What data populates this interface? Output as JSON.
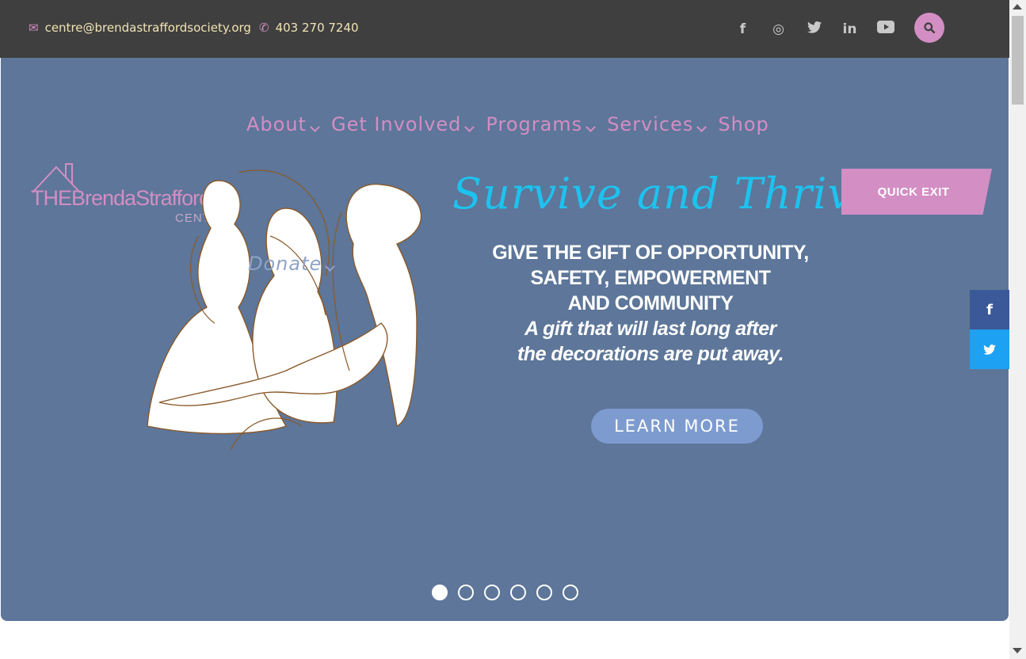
{
  "topbar": {
    "email": "centre@brendastraffordsociety.org",
    "phone": "403 270 7240",
    "email_icon": "envelope-icon",
    "phone_icon": "phone-icon",
    "social": [
      {
        "name": "facebook-icon",
        "glyph": "f"
      },
      {
        "name": "instagram-icon",
        "glyph": "◎"
      },
      {
        "name": "twitter-icon",
        "glyph": "🐦"
      },
      {
        "name": "linkedin-icon",
        "glyph": "in"
      },
      {
        "name": "youtube-icon",
        "glyph": "▶"
      }
    ],
    "search_icon": "search-icon"
  },
  "nav": {
    "items": [
      {
        "label": "About",
        "has_dropdown": true
      },
      {
        "label": "Get Involved",
        "has_dropdown": true
      },
      {
        "label": "Programs",
        "has_dropdown": true
      },
      {
        "label": "Services",
        "has_dropdown": true
      },
      {
        "label": "Shop",
        "has_dropdown": false
      }
    ],
    "donate": "Donate"
  },
  "logo": {
    "text": "THEBrendaStrafford",
    "sub": "CENTRE"
  },
  "hero": {
    "script_title": "Survive and Thrive",
    "headline_1": "GIVE THE GIFT OF OPPORTUNITY,",
    "headline_2": "SAFETY, EMPOWERMENT",
    "headline_3": "AND COMMUNITY",
    "tagline_1": "A gift that will last long after",
    "tagline_2": "the decorations are put away.",
    "cta": "LEARN MORE"
  },
  "quick_exit": "QUICK EXIT",
  "slider": {
    "count": 6,
    "active_index": 0
  },
  "share": {
    "facebook": "f",
    "twitter": "🐦"
  },
  "colors": {
    "topbar_bg": "#3f3f3f",
    "hero_bg": "#5d7699",
    "accent_pink": "#d38ec4",
    "script_cyan": "#1ec2ef",
    "cta_blue": "#7d9bcf"
  }
}
